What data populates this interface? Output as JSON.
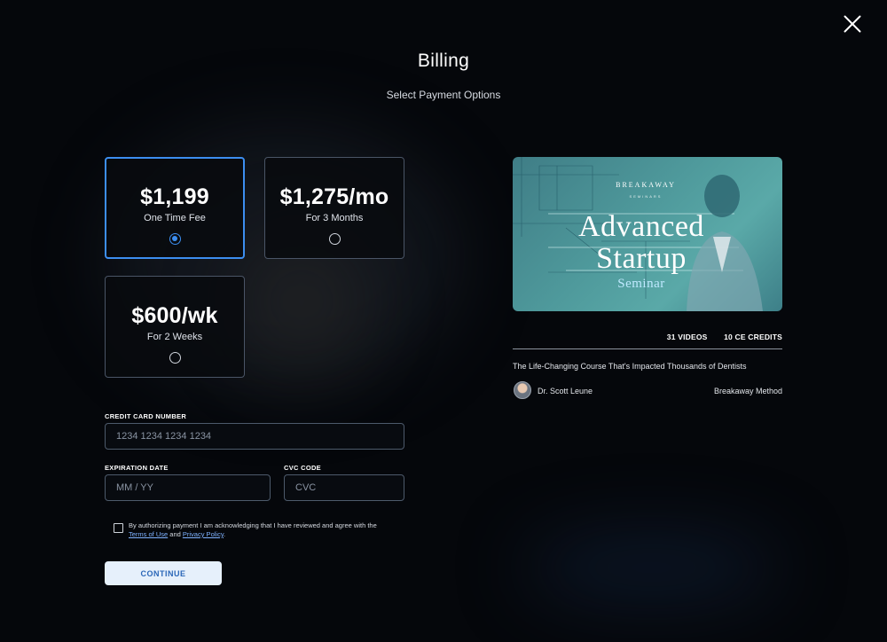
{
  "page": {
    "title": "Billing",
    "subtitle": "Select Payment Options"
  },
  "payment_options": [
    {
      "price": "$1,199",
      "description": "One Time Fee",
      "selected": true
    },
    {
      "price": "$1,275/mo",
      "description": "For 3 Months",
      "selected": false
    },
    {
      "price": "$600/wk",
      "description": "For 2 Weeks",
      "selected": false
    }
  ],
  "form": {
    "card_number_label": "CREDIT CARD NUMBER",
    "card_number_placeholder": "1234 1234 1234 1234",
    "expiration_label": "EXPIRATION DATE",
    "expiration_placeholder": "MM / YY",
    "cvc_label": "CVC CODE",
    "cvc_placeholder": "CVC",
    "terms_prefix": "By authorizing payment I am acknowledging that I have reviewed and agree with the",
    "terms_link": "Terms of Use",
    "terms_and": "and",
    "privacy_link": "Privacy Policy",
    "terms_suffix": ".",
    "continue_label": "CONTINUE"
  },
  "course": {
    "brand": "BREAKAWAY",
    "brand_sub": "SEMINARS",
    "title_line1": "Advanced",
    "title_line2": "Startup",
    "title_line3": "Seminar",
    "videos": "31 VIDEOS",
    "credits": "10 CE CREDITS",
    "tagline": "The Life-Changing Course That's Impacted Thousands of Dentists",
    "author": "Dr. Scott Leune",
    "publisher": "Breakaway Method"
  },
  "colors": {
    "background": "#05070b",
    "accent": "#3c8ef0",
    "button_bg": "#e6f0fb",
    "button_text": "#2b67b8",
    "thumbnail_teal": "#4f9a9c"
  },
  "icons": {
    "close": "close-icon",
    "radio": "radio-icon",
    "checkbox": "checkbox-icon"
  }
}
